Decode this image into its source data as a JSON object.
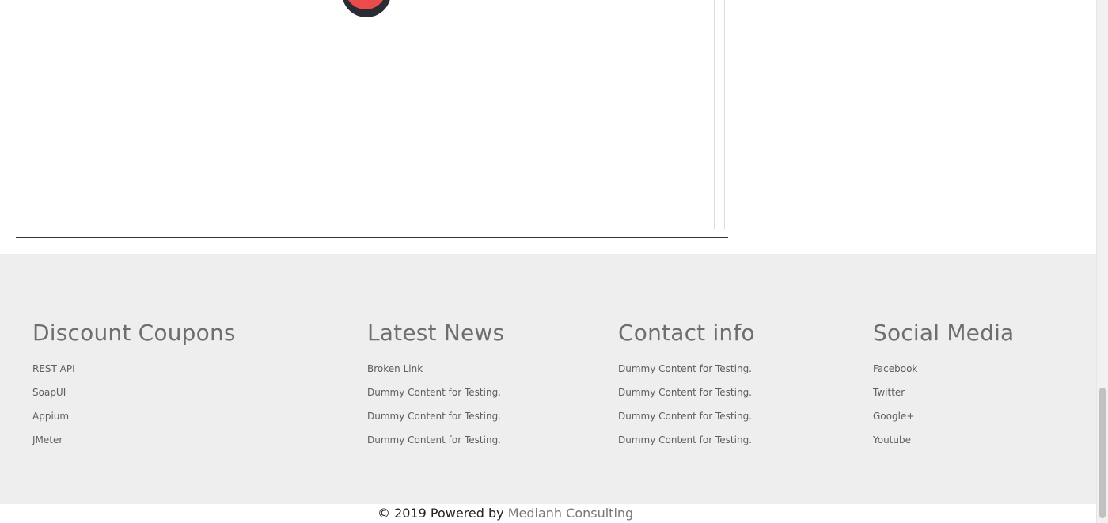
{
  "footer": {
    "columns": [
      {
        "heading": "Discount Coupons",
        "links": [
          "REST API",
          "SoapUI",
          "Appium",
          "JMeter"
        ]
      },
      {
        "heading": "Latest News",
        "links": [
          "Broken Link",
          "Dummy Content for Testing.",
          "Dummy Content for Testing.",
          "Dummy Content for Testing."
        ]
      },
      {
        "heading": "Contact info",
        "links": [
          "Dummy Content for Testing.",
          "Dummy Content for Testing.",
          "Dummy Content for Testing.",
          "Dummy Content for Testing."
        ]
      },
      {
        "heading": "Social Media",
        "links": [
          "Facebook",
          "Twitter",
          "Google+",
          "Youtube"
        ]
      }
    ]
  },
  "copyright": {
    "prefix": "© 2019 Powered by",
    "company": "Medianh Consulting"
  },
  "colors": {
    "footer_bg": "#eeeeee",
    "heading": "#6e6e6e",
    "logo_red": "#ea4c4c",
    "logo_dark": "#2b2b33"
  }
}
